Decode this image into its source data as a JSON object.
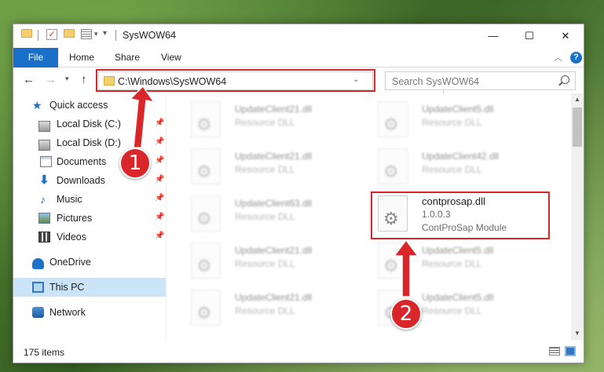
{
  "window": {
    "title": "SysWOW64",
    "controls": {
      "minimize": "—",
      "maximize": "☐",
      "close": "✕"
    }
  },
  "ribbon": {
    "tabs": [
      "File",
      "Home",
      "Share",
      "View"
    ],
    "help": "?"
  },
  "address": {
    "path": "C:\\Windows\\SysWOW64",
    "search_placeholder": "Search SysWOW64"
  },
  "navpane": {
    "items": [
      {
        "label": "Quick access",
        "icon": "star-icon"
      },
      {
        "label": "Local Disk (C:)",
        "icon": "disk-icon",
        "pinned": true
      },
      {
        "label": "Local Disk (D:)",
        "icon": "disk-icon",
        "pinned": true
      },
      {
        "label": "Documents",
        "icon": "documents-icon",
        "pinned": true
      },
      {
        "label": "Downloads",
        "icon": "downloads-icon",
        "pinned": true
      },
      {
        "label": "Music",
        "icon": "music-icon",
        "pinned": true
      },
      {
        "label": "Pictures",
        "icon": "pictures-icon",
        "pinned": true
      },
      {
        "label": "Videos",
        "icon": "videos-icon",
        "pinned": true
      },
      {
        "label": "OneDrive",
        "icon": "onedrive-icon"
      },
      {
        "label": "This PC",
        "icon": "pc-icon",
        "selected": true
      },
      {
        "label": "Network",
        "icon": "network-icon"
      }
    ]
  },
  "files": {
    "left": [
      {
        "name": "UpdateClient21.dll",
        "desc": "Resource DLL"
      },
      {
        "name": "UpdateClient21.dll",
        "desc": "Resource DLL"
      },
      {
        "name": "UpdateClient63.dll",
        "desc": "Resource DLL"
      },
      {
        "name": "UpdateClient21.dll",
        "desc": "Resource DLL"
      },
      {
        "name": "UpdateClient21.dll",
        "desc": "Resource DLL"
      }
    ],
    "right": [
      {
        "name": "UpdateClient5.dll",
        "desc": "Resource DLL"
      },
      {
        "name": "UpdateClient42.dll",
        "desc": "Resource DLL"
      },
      {
        "name": "contprosap.dll",
        "version": "1.0.0.3",
        "desc": "ContProSap Module",
        "highlighted": true
      },
      {
        "name": "UpdateClient5.dll",
        "desc": "Resource DLL"
      },
      {
        "name": "UpdateClient5.dll",
        "desc": "Resource DLL"
      }
    ]
  },
  "status": {
    "count": "175 items"
  },
  "callouts": [
    "1",
    "2"
  ],
  "colors": {
    "accent": "#1a6fc9",
    "highlight_red": "#d9262a",
    "selected_bg": "#cce4f7"
  }
}
